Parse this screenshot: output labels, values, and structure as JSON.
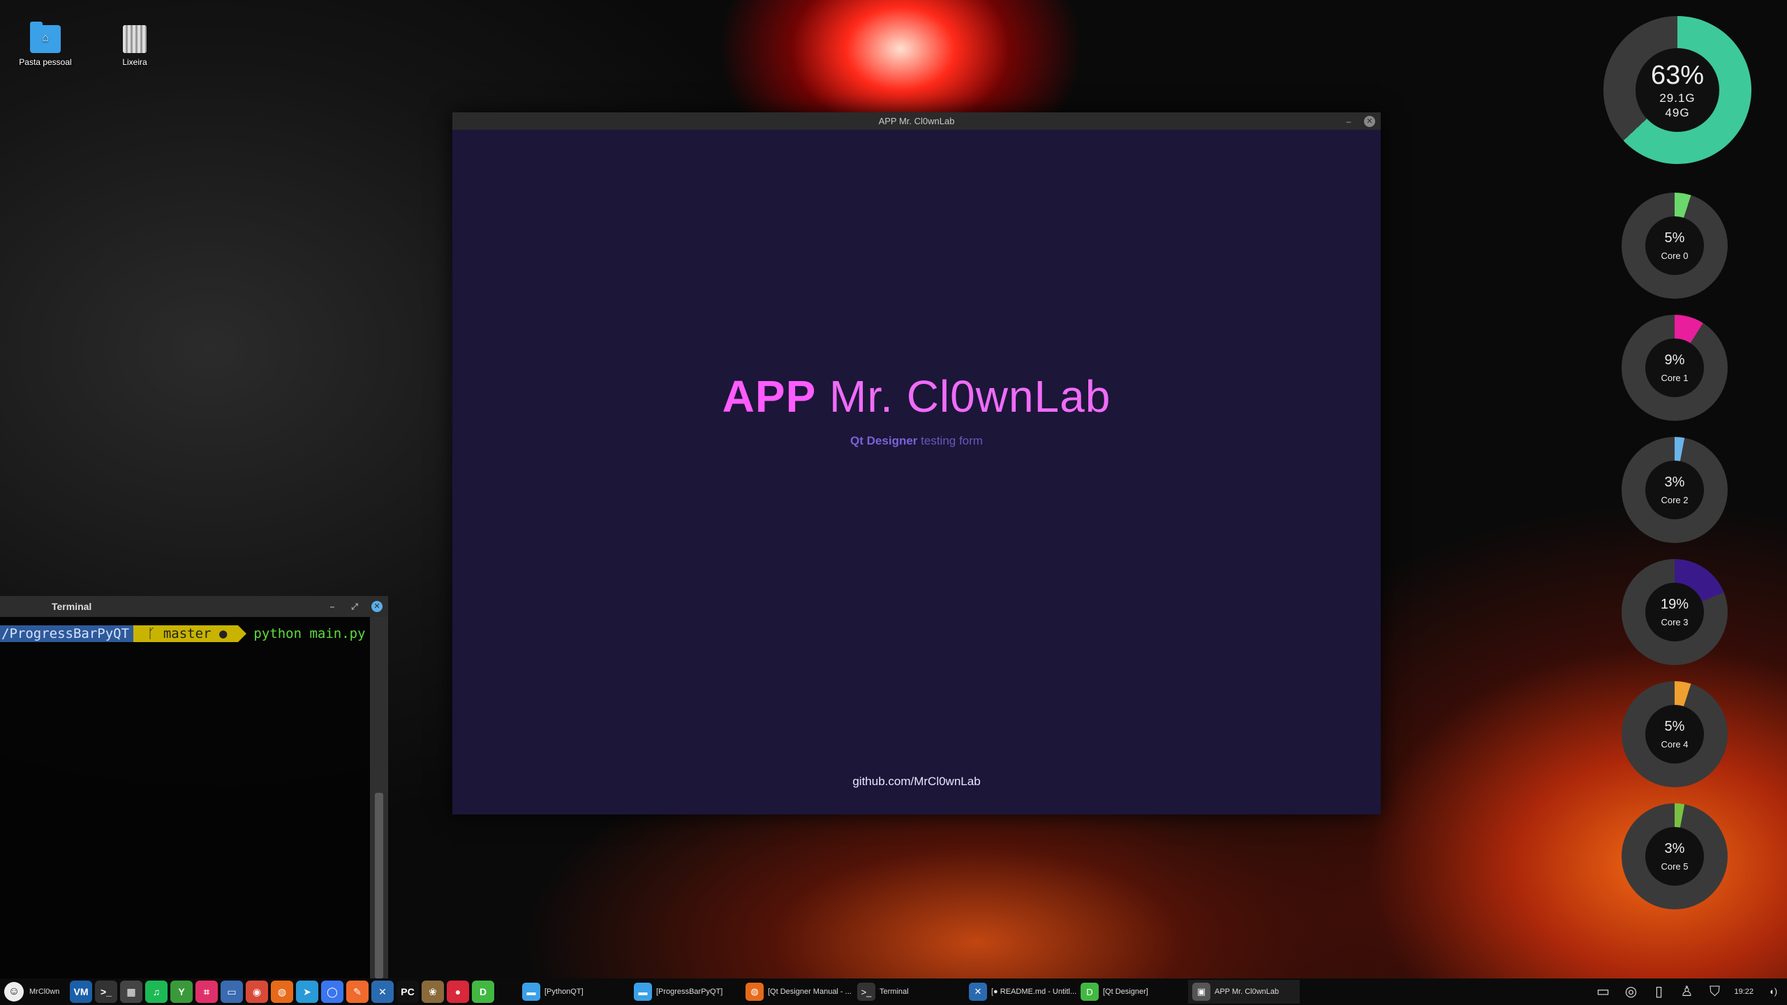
{
  "desktop": {
    "icons": [
      {
        "label": "Pasta pessoal",
        "icon": "home-folder-icon"
      },
      {
        "label": "Lixeira",
        "icon": "trash-icon"
      }
    ]
  },
  "app_window": {
    "title": "APP Mr. Cl0wnLab",
    "heading_bold": "APP",
    "heading_light": "Mr. Cl0wnLab",
    "subtitle_bold": "Qt Designer",
    "subtitle_rest": "testing form",
    "link": "github.com/MrCl0wnLab",
    "minimize_glyph": "–",
    "close_glyph": "✕"
  },
  "terminal": {
    "title": "Terminal",
    "prompt_path": "/ProgressBarPyQT",
    "prompt_branch": "ᚴ master ●",
    "command": "python main.py",
    "minimize_glyph": "–",
    "maximize_glyph": "⤢",
    "close_glyph": "✕"
  },
  "memory_gauge": {
    "percent": "63%",
    "used": "29.1G",
    "total": "49G",
    "value": 0.63,
    "color": "#3ec99a"
  },
  "cpu_gauges": [
    {
      "percent": "5%",
      "label": "Core 0",
      "value": 0.05,
      "color": "#6bd86b"
    },
    {
      "percent": "9%",
      "label": "Core 1",
      "value": 0.09,
      "color": "#e91e9c"
    },
    {
      "percent": "3%",
      "label": "Core 2",
      "value": 0.03,
      "color": "#6ab4ea"
    },
    {
      "percent": "19%",
      "label": "Core 3",
      "value": 0.19,
      "color": "#3a1a8a"
    },
    {
      "percent": "5%",
      "label": "Core 4",
      "value": 0.05,
      "color": "#f0a030"
    },
    {
      "percent": "3%",
      "label": "Core 5",
      "value": 0.03,
      "color": "#7ac143"
    }
  ],
  "taskbar": {
    "user": "MrCl0wn",
    "launchers": [
      {
        "icon": "vm-icon",
        "glyph": "VM",
        "color": "#1b5fa8"
      },
      {
        "icon": "terminal-icon",
        "glyph": ">_",
        "color": "#333333"
      },
      {
        "icon": "monitor-icon",
        "glyph": "▦",
        "color": "#444444"
      },
      {
        "icon": "spotify-icon",
        "glyph": "♫",
        "color": "#1db954"
      },
      {
        "icon": "app-icon",
        "glyph": "Y",
        "color": "#3a9a3a"
      },
      {
        "icon": "crop-icon",
        "glyph": "⌗",
        "color": "#e0306a"
      },
      {
        "icon": "drive-icon",
        "glyph": "▭",
        "color": "#3a6ab0"
      },
      {
        "icon": "chrome-icon",
        "glyph": "◉",
        "color": "#d84a38"
      },
      {
        "icon": "firefox-icon",
        "glyph": "◍",
        "color": "#e66a1a"
      },
      {
        "icon": "telegram-icon",
        "glyph": "➤",
        "color": "#2a9ad8"
      },
      {
        "icon": "signal-icon",
        "glyph": "◯",
        "color": "#3a76f0"
      },
      {
        "icon": "postman-icon",
        "glyph": "✎",
        "color": "#ef6a2c"
      },
      {
        "icon": "vscode-icon",
        "glyph": "✕",
        "color": "#2a6ab0"
      },
      {
        "icon": "pycharm-icon",
        "glyph": "PC",
        "color": "#111111"
      },
      {
        "icon": "gimp-icon",
        "glyph": "❀",
        "color": "#8a6a3a"
      },
      {
        "icon": "chat-icon",
        "glyph": "●",
        "color": "#d8283a"
      },
      {
        "icon": "designer-icon",
        "glyph": "D",
        "color": "#42b842"
      }
    ],
    "tasks": [
      {
        "label": "[PythonQT]",
        "icon": "folder-icon",
        "glyph": "▬",
        "color": "#3aa0e8"
      },
      {
        "label": "[ProgressBarPyQT]",
        "icon": "folder-icon",
        "glyph": "▬",
        "color": "#3aa0e8"
      },
      {
        "label": "[Qt Designer Manual - ...",
        "icon": "firefox-icon",
        "glyph": "◍",
        "color": "#e66a1a"
      },
      {
        "label": "Terminal",
        "icon": "terminal-icon",
        "glyph": ">_",
        "color": "#333333"
      },
      {
        "label": "[● README.md - Untitl...",
        "icon": "vscode-icon",
        "glyph": "✕",
        "color": "#2a6ab0"
      },
      {
        "label": "[Qt Designer]",
        "icon": "designer-icon",
        "glyph": "D",
        "color": "#42b842"
      },
      {
        "label": "APP Mr. Cl0wnLab",
        "icon": "app-window-icon",
        "glyph": "▣",
        "color": "#555555"
      }
    ],
    "tray": [
      {
        "icon": "display-icon",
        "glyph": "▭"
      },
      {
        "icon": "network-icon",
        "glyph": "◎"
      },
      {
        "icon": "clipboard-icon",
        "glyph": "▯"
      },
      {
        "icon": "user-icon",
        "glyph": "♙"
      },
      {
        "icon": "shield-icon",
        "glyph": "⛉"
      }
    ],
    "clock": "19:22",
    "volume_glyph": "◖)"
  }
}
